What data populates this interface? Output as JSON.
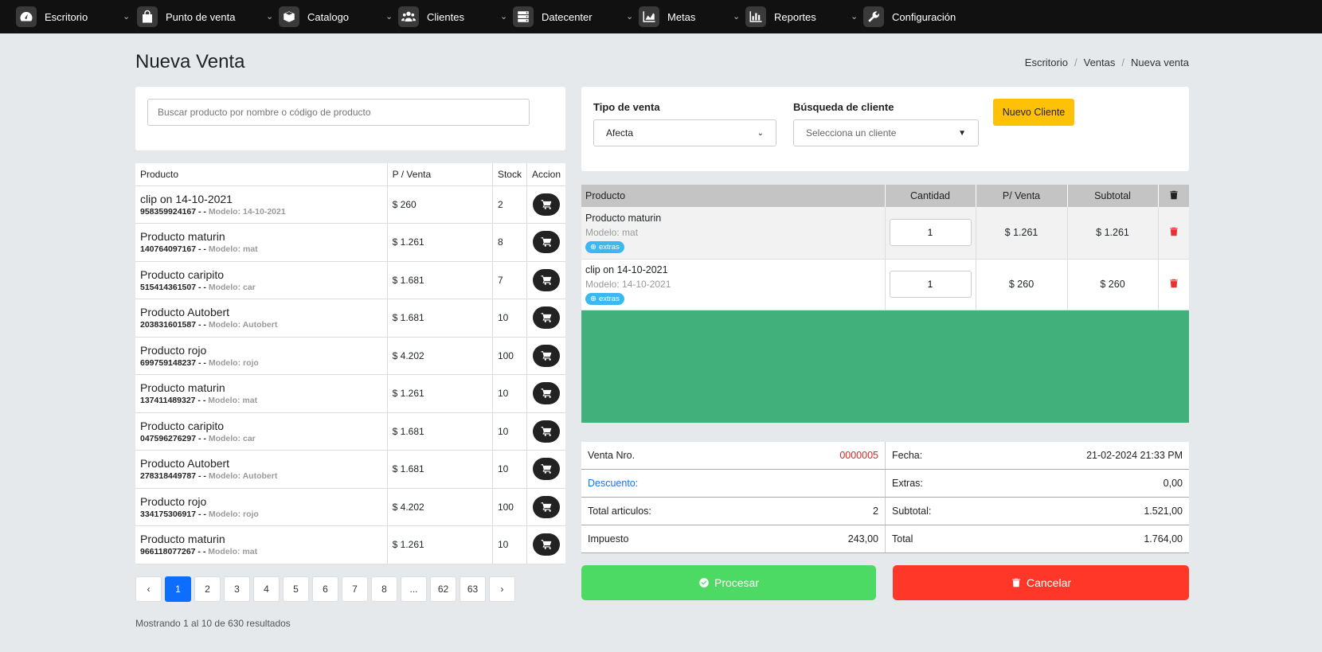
{
  "nav": [
    {
      "label": "Escritorio",
      "icon": "dashboard-icon"
    },
    {
      "label": "Punto de venta",
      "icon": "shopping-bag-icon"
    },
    {
      "label": "Catalogo",
      "icon": "box-icon"
    },
    {
      "label": "Clientes",
      "icon": "users-icon"
    },
    {
      "label": "Datecenter",
      "icon": "server-icon"
    },
    {
      "label": "Metas",
      "icon": "area-chart-icon"
    },
    {
      "label": "Reportes",
      "icon": "bar-chart-icon"
    },
    {
      "label": "Configuración",
      "icon": "wrench-icon"
    }
  ],
  "page": {
    "title": "Nueva Venta"
  },
  "breadcrumb": [
    "Escritorio",
    "Ventas",
    "Nueva venta"
  ],
  "search": {
    "placeholder": "Buscar producto por nombre o código de producto"
  },
  "products": {
    "headers": [
      "Producto",
      "P / Venta",
      "Stock",
      "Accion"
    ],
    "rows": [
      {
        "name": "clip on 14-10-2021",
        "code": "958359924167 - -",
        "model": "Modelo: 14-10-2021",
        "price": "$ 260",
        "stock": "2"
      },
      {
        "name": "Producto maturin",
        "code": "140764097167 - -",
        "model": "Modelo: mat",
        "price": "$ 1.261",
        "stock": "8"
      },
      {
        "name": "Producto caripito",
        "code": "515414361507 - -",
        "model": "Modelo: car",
        "price": "$ 1.681",
        "stock": "7"
      },
      {
        "name": "Producto Autobert",
        "code": "203831601587 - -",
        "model": "Modelo: Autobert",
        "price": "$ 1.681",
        "stock": "10"
      },
      {
        "name": "Producto rojo",
        "code": "699759148237 - -",
        "model": "Modelo: rojo",
        "price": "$ 4.202",
        "stock": "100"
      },
      {
        "name": "Producto maturin",
        "code": "137411489327 - -",
        "model": "Modelo: mat",
        "price": "$ 1.261",
        "stock": "10"
      },
      {
        "name": "Producto caripito",
        "code": "047596276297 - -",
        "model": "Modelo: car",
        "price": "$ 1.681",
        "stock": "10"
      },
      {
        "name": "Producto Autobert",
        "code": "278318449787 - -",
        "model": "Modelo: Autobert",
        "price": "$ 1.681",
        "stock": "10"
      },
      {
        "name": "Producto rojo",
        "code": "334175306917 - -",
        "model": "Modelo: rojo",
        "price": "$ 4.202",
        "stock": "100"
      },
      {
        "name": "Producto maturin",
        "code": "966118077267 - -",
        "model": "Modelo: mat",
        "price": "$ 1.261",
        "stock": "10"
      }
    ]
  },
  "pagination": {
    "items": [
      "‹",
      "1",
      "2",
      "3",
      "4",
      "5",
      "6",
      "7",
      "8",
      "...",
      "62",
      "63",
      "›"
    ],
    "active": "1"
  },
  "results_text": "Mostrando 1 al 10 de 630 resultados",
  "sale_type": {
    "label": "Tipo de venta",
    "value": "Afecta"
  },
  "client_search": {
    "label": "Búsqueda de cliente",
    "placeholder": "Selecciona un cliente"
  },
  "new_client_button": "Nuevo Cliente",
  "cart": {
    "headers": [
      "Producto",
      "Cantidad",
      "P/ Venta",
      "Subtotal"
    ],
    "rows": [
      {
        "name": "Producto maturin",
        "model": "Modelo: mat",
        "badge": "extras",
        "qty": "1",
        "price": "$ 1.261",
        "subtotal": "$ 1.261"
      },
      {
        "name": "clip on 14-10-2021",
        "model": "Modelo: 14-10-2021",
        "badge": "extras",
        "qty": "1",
        "price": "$ 260",
        "subtotal": "$ 260"
      }
    ]
  },
  "summary": {
    "sale_number_label": "Venta Nro.",
    "sale_number": "0000005",
    "date_label": "Fecha:",
    "date": "21-02-2024 21:33 PM",
    "discount_label": "Descuento:",
    "extras_label": "Extras:",
    "extras": "0,00",
    "total_items_label": "Total articulos:",
    "total_items": "2",
    "subtotal_label": "Subtotal:",
    "subtotal": "1.521,00",
    "tax_label": "Impuesto",
    "tax": "243,00",
    "total_label": "Total",
    "total": "1.764,00"
  },
  "actions": {
    "process": "Procesar",
    "cancel": "Cancelar"
  },
  "colors": {
    "accent_blue": "#0d6efd",
    "yellow": "#ffc107",
    "green": "#4cd964",
    "red": "#ff3729",
    "cart_area": "#42b07a"
  }
}
